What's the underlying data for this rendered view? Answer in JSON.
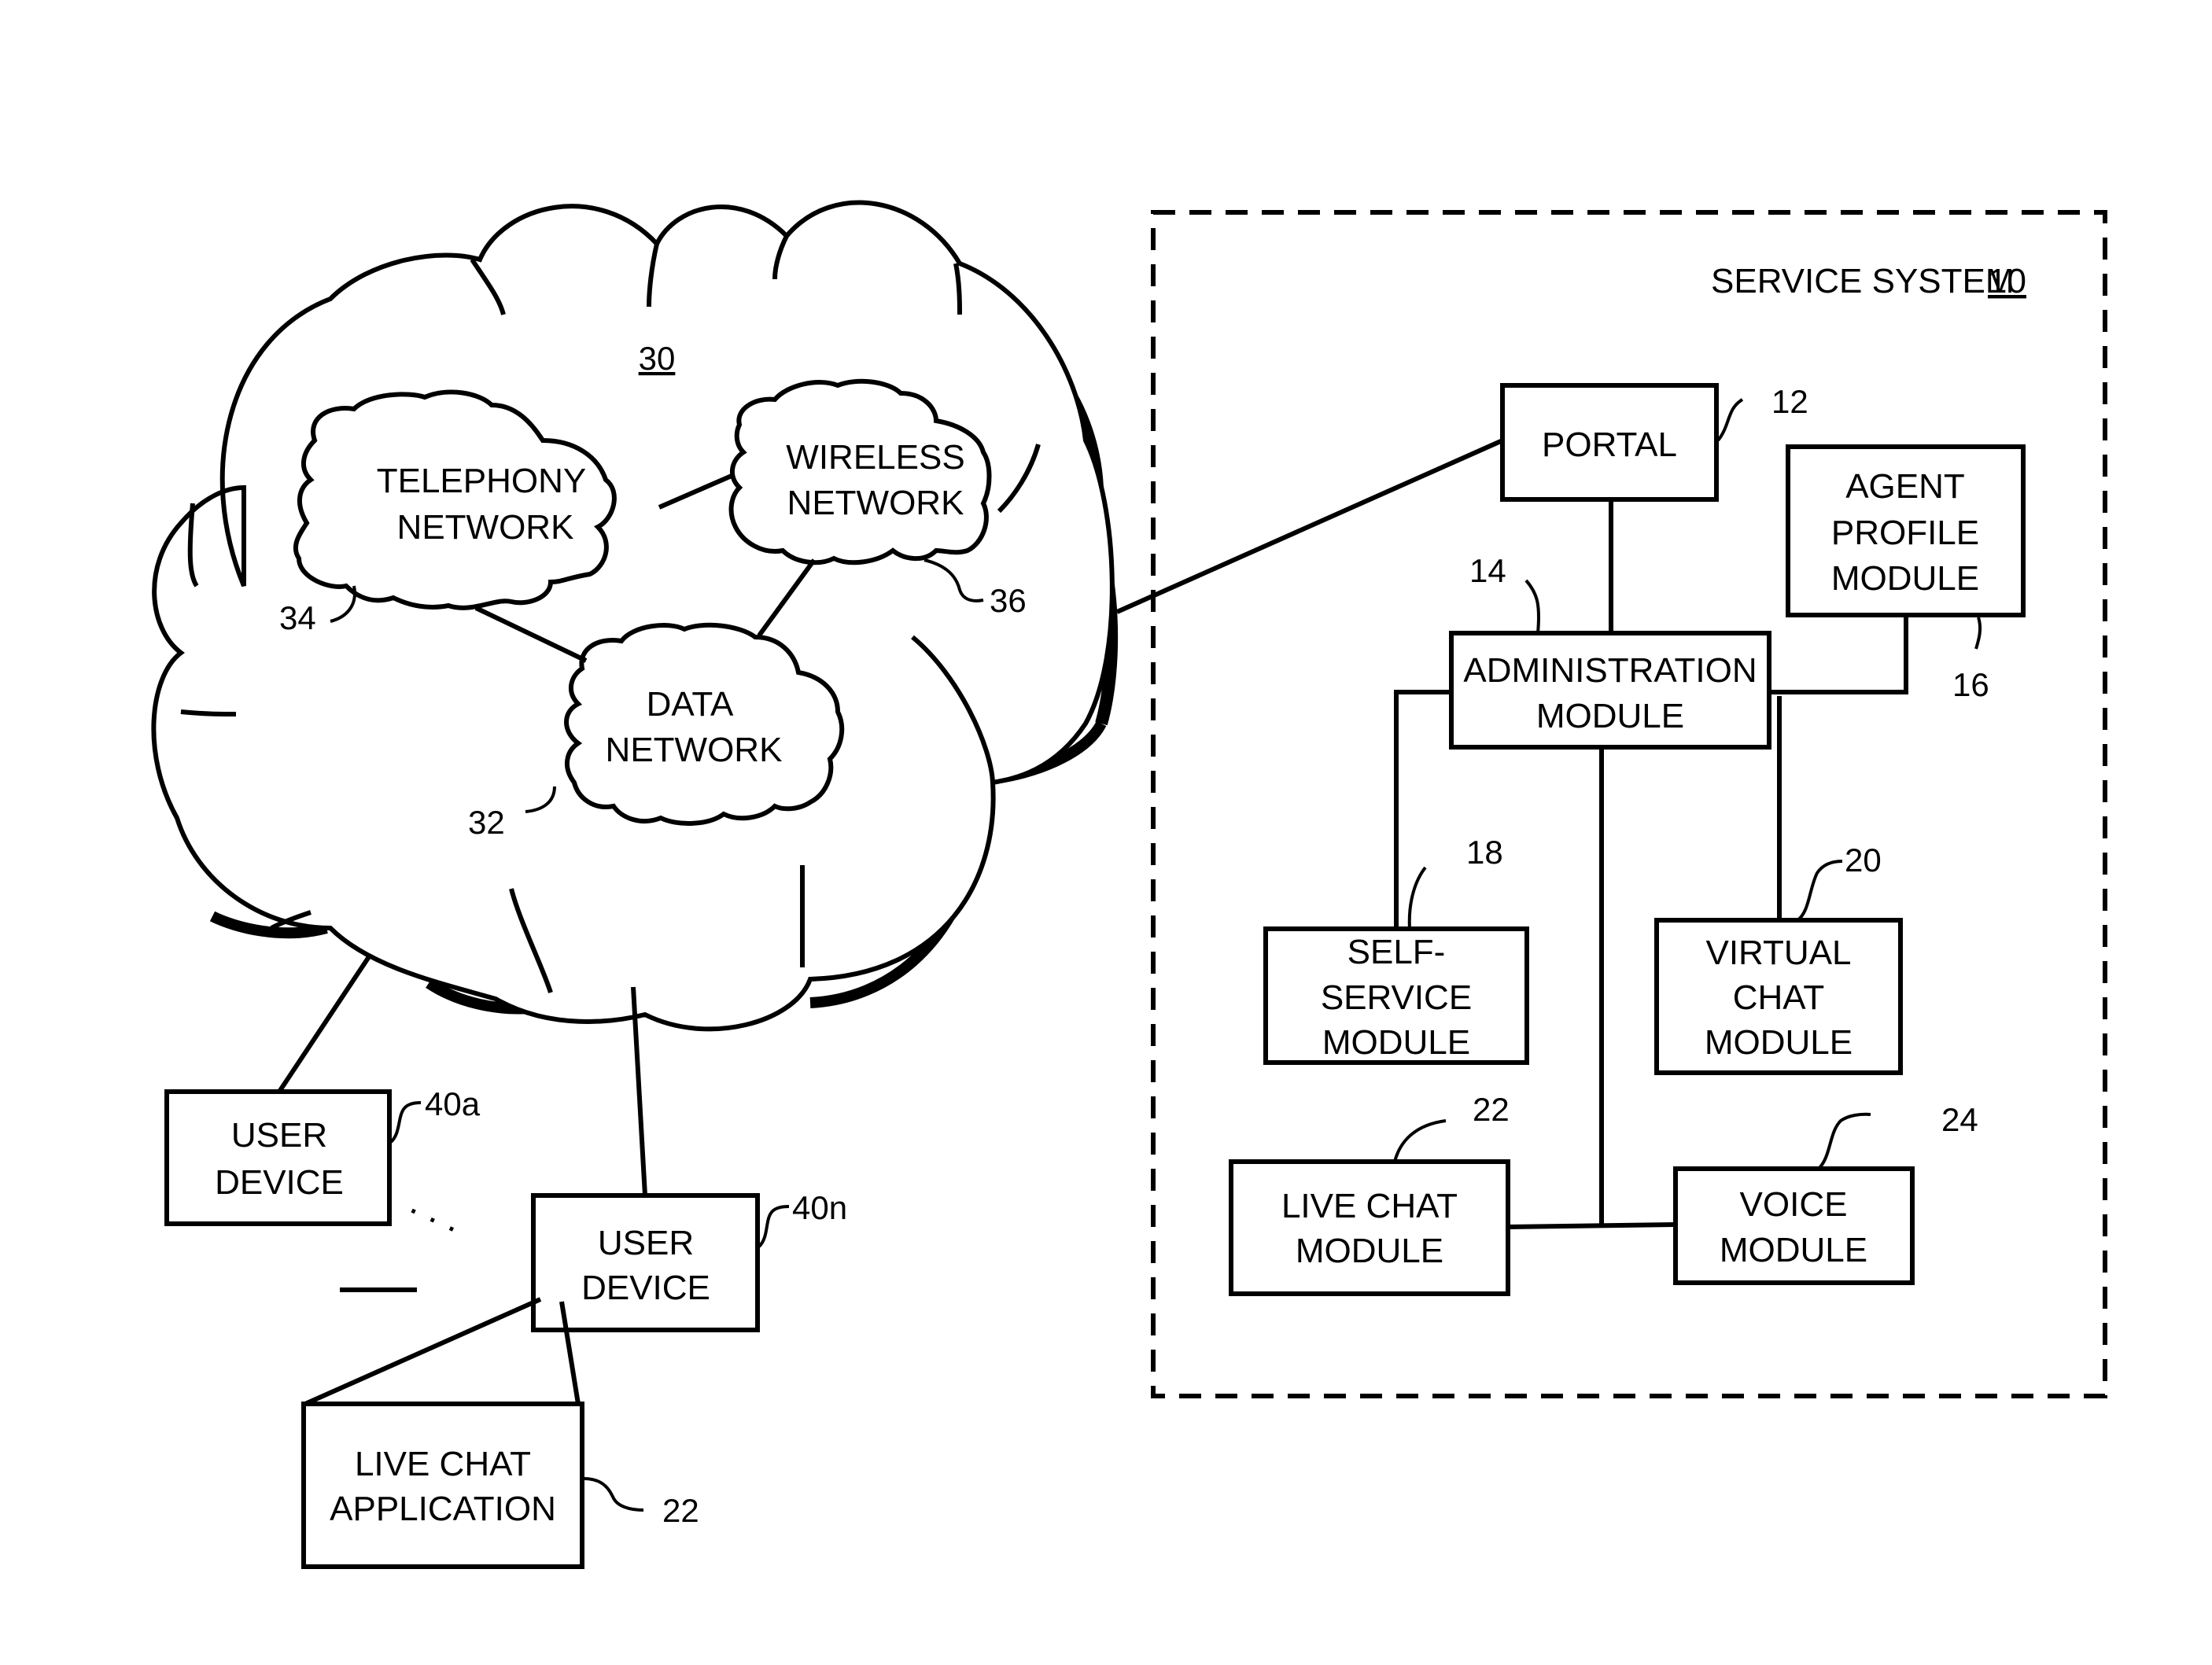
{
  "service_system": {
    "title": "SERVICE SYSTEM",
    "ref": "10",
    "modules": {
      "portal": {
        "lines": [
          "PORTAL"
        ],
        "ref": "12"
      },
      "administration": {
        "lines": [
          "ADMINISTRATION",
          "MODULE"
        ],
        "ref": "14"
      },
      "agent_profile": {
        "lines": [
          "AGENT",
          "PROFILE",
          "MODULE"
        ],
        "ref": "16"
      },
      "self_service": {
        "lines": [
          "SELF-",
          "SERVICE",
          "MODULE"
        ],
        "ref": "18"
      },
      "virtual_chat": {
        "lines": [
          "VIRTUAL",
          "CHAT",
          "MODULE"
        ],
        "ref": "20"
      },
      "live_chat": {
        "lines": [
          "LIVE CHAT",
          "MODULE"
        ],
        "ref": "22"
      },
      "voice": {
        "lines": [
          "VOICE",
          "MODULE"
        ],
        "ref": "24"
      }
    }
  },
  "network": {
    "ref": "30",
    "data_network": {
      "lines": [
        "DATA",
        "NETWORK"
      ],
      "ref": "32"
    },
    "telephony_network": {
      "lines": [
        "TELEPHONY",
        "NETWORK"
      ],
      "ref": "34"
    },
    "wireless_network": {
      "lines": [
        "WIRELESS",
        "NETWORK"
      ],
      "ref": "36"
    }
  },
  "user_devices": {
    "device_a": {
      "lines": [
        "USER",
        "DEVICE"
      ],
      "ref": "40a"
    },
    "device_n": {
      "lines": [
        "USER",
        "DEVICE"
      ],
      "ref": "40n"
    },
    "ellipsis": ". . ."
  },
  "live_chat_application": {
    "lines": [
      "LIVE CHAT",
      "APPLICATION"
    ],
    "ref": "22"
  }
}
